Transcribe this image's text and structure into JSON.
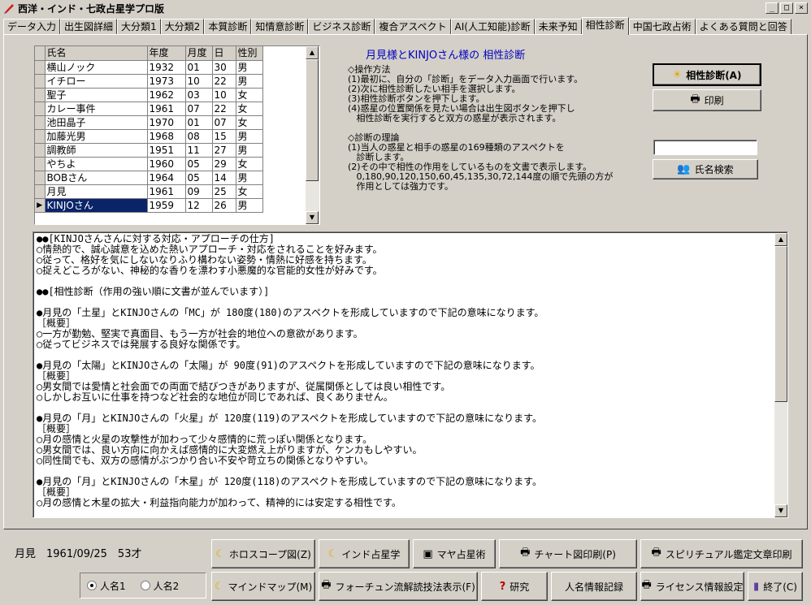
{
  "window": {
    "title": "西洋・インド・七政占星学プロ版",
    "min": "_",
    "max": "□",
    "close": "×"
  },
  "tabs": [
    "データ入力",
    "出生図詳細",
    "大分類1",
    "大分類2",
    "本質診断",
    "知情意診断",
    "ビジネス診断",
    "複合アスペクト",
    "AI(人工知能)診断",
    "未来予知",
    "相性診断",
    "中国七政占術",
    "よくある質問と回答"
  ],
  "active_tab": 10,
  "grid": {
    "headers": [
      "氏名",
      "年度",
      "月度",
      "日",
      "性別"
    ],
    "rows": [
      [
        "横山ノック",
        "1932",
        "01",
        "30",
        "男"
      ],
      [
        "イチロー",
        "1973",
        "10",
        "22",
        "男"
      ],
      [
        "聖子",
        "1962",
        "03",
        "10",
        "女"
      ],
      [
        "カレー事件",
        "1961",
        "07",
        "22",
        "女"
      ],
      [
        "池田晶子",
        "1970",
        "01",
        "07",
        "女"
      ],
      [
        "加藤光男",
        "1968",
        "08",
        "15",
        "男"
      ],
      [
        "調教師",
        "1951",
        "11",
        "27",
        "男"
      ],
      [
        "やちよ",
        "1960",
        "05",
        "29",
        "女"
      ],
      [
        "BOBさん",
        "1964",
        "05",
        "14",
        "男"
      ],
      [
        "月見",
        "1961",
        "09",
        "25",
        "女"
      ],
      [
        "KINJOさん",
        "1959",
        "12",
        "26",
        "男"
      ]
    ],
    "selected_row": 10,
    "current_marker": "▶"
  },
  "diagnosis_title": "月見様とKINJOさん様の 相性診断",
  "instructions": "◇操作方法\n(1)最初に、自分の「診断」をデータ入力画面で行います。\n(2)次に相性診断したい相手を選択します。\n(3)相性診断ボタンを押下します。\n(4)惑星の位置関係を見たい場合は出生図ボタンを押下し\n   相性診断を実行すると双方の惑星が表示されます。\n\n◇診断の理論\n(1)当人の惑星と相手の惑星の169種類のアスペクトを\n   診断します。\n(2)その中で相性の作用をしているものを文書で表示します。\n   0,180,90,120,150,60,45,135,30,72,144度の順で先頭の方が\n   作用としては強力です。",
  "buttons": {
    "compat": "相性診断(A)",
    "print": "印刷",
    "name_search": "氏名検索",
    "horoscope": "ホロスコープ図(Z)",
    "indian": "インド占星学",
    "maya": "マヤ占星術",
    "chart_print": "チャート図印刷(P)",
    "spiritual_print": "スピリチュアル鑑定文章印刷",
    "mindmap": "マインドマップ(M)",
    "fortune": "フォーチュン流解読技法表示(F)",
    "research": "研究",
    "person_record": "人名情報記録",
    "license": "ライセンス情報設定",
    "exit": "終了(C)"
  },
  "search_value": "",
  "memo_lines": [
    "●●[KINJOさんさんに対する対応・アプローチの仕方]",
    "○情熱的で、誠心誠意を込めた熱いアプローチ・対応をされることを好みます。",
    "○従って、格好を気にしないなりふり構わない姿勢・情熱に好感を持ちます。",
    "○捉えどころがない、神秘的な香りを漂わす小悪魔的な官能的女性が好みです。",
    "",
    "●●[相性診断（作用の強い順に文書が並んでいます）]",
    "",
    "●月見の「土星」とKINJOさんの「MC」が 180度(180)のアスペクトを形成していますので下記の意味になります。",
    "［概要］",
    "○一方が勤勉、堅実で真面目、もう一方が社会的地位への意欲があります。",
    "○従ってビジネスでは発展する良好な関係です。",
    "",
    "●月見の「太陽」とKINJOさんの「太陽」が 90度(91)のアスペクトを形成していますので下記の意味になります。",
    "［概要］",
    "○男女間では愛情と社会面での両面で結びつきがありますが、従属関係としては良い相性です。",
    "○しかしお互いに仕事を持つなど社会的な地位が同じであれば、良くありません。",
    "",
    "●月見の「月」とKINJOさんの「火星」が 120度(119)のアスペクトを形成していますので下記の意味になります。",
    "［概要］",
    "○月の感情と火星の攻撃性が加わって少々感情的に荒っぽい関係となります。",
    "○男女間では、良い方向に向かえば感情的に大変燃え上がりますが、ケンカもしやすい。",
    "○同性間でも、双方の感情がぶつかり合い不安や苛立ちの関係となりやすい。",
    "",
    "●月見の「月」とKINJOさんの「木星」が 120度(118)のアスペクトを形成していますので下記の意味になります。",
    "［概要］",
    "○月の感情と木星の拡大・利益指向能力が加わって、精神的には安定する相性です。"
  ],
  "status_text": "月見　1961/09/25　53才",
  "radio": {
    "opt1": "人名1",
    "opt2": "人名2",
    "selected": 1
  },
  "colors": {
    "face": "#d4d0c8",
    "selection": "#0a246a",
    "title_blue": "#0000c0"
  }
}
